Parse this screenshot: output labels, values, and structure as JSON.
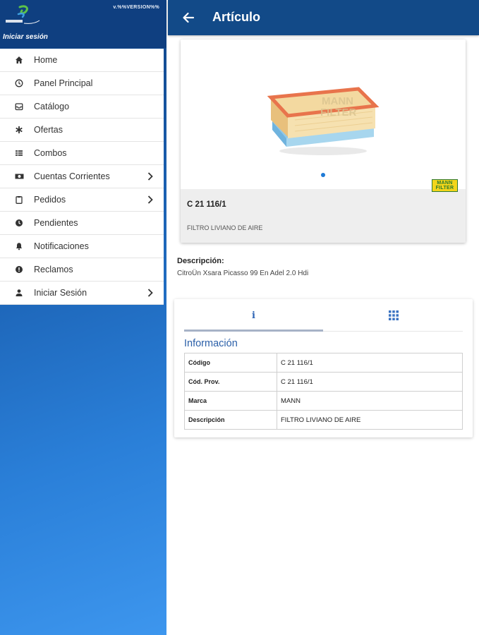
{
  "sidebar": {
    "version": "v.%%VERSION%%",
    "login_title": "Iniciar sesión",
    "items": [
      {
        "label": "Home",
        "icon": "home-icon",
        "chevron": false
      },
      {
        "label": "Panel Principal",
        "icon": "clock-icon",
        "chevron": false
      },
      {
        "label": "Catálogo",
        "icon": "inbox-icon",
        "chevron": false
      },
      {
        "label": "Ofertas",
        "icon": "asterisk-icon",
        "chevron": false
      },
      {
        "label": "Combos",
        "icon": "table-icon",
        "chevron": false
      },
      {
        "label": "Cuentas Corrientes",
        "icon": "money-icon",
        "chevron": true
      },
      {
        "label": "Pedidos",
        "icon": "clipboard-icon",
        "chevron": true
      },
      {
        "label": "Pendientes",
        "icon": "clock-filled-icon",
        "chevron": false
      },
      {
        "label": "Notificaciones",
        "icon": "bell-icon",
        "chevron": false
      },
      {
        "label": "Reclamos",
        "icon": "alert-icon",
        "chevron": false
      },
      {
        "label": "Iniciar Sesión",
        "icon": "person-icon",
        "chevron": true
      }
    ]
  },
  "appbar": {
    "title": "Artículo"
  },
  "product": {
    "code": "C 21 116/1",
    "name": "FILTRO LIVIANO DE AIRE",
    "brand_logo_line1": "MANN",
    "brand_logo_line2": "FILTER",
    "image_watermark_line1": "MANN",
    "image_watermark_line2": "FILTER"
  },
  "description": {
    "label": "Descripción:",
    "text": "CitroÜn Xsara Picasso 99 En Adel 2.0 Hdi"
  },
  "info": {
    "section_title": "Información",
    "tab_info_glyph": "i",
    "rows": [
      {
        "key": "Código",
        "value": "C 21 116/1"
      },
      {
        "key": "Cód. Prov.",
        "value": "C 21 116/1"
      },
      {
        "key": "Marca",
        "value": "MANN"
      },
      {
        "key": "Descripción",
        "value": "FILTRO LIVIANO DE AIRE"
      }
    ]
  },
  "colors": {
    "appbar": "#124a88",
    "accent": "#2a5fa8",
    "dot": "#1e7ad6"
  }
}
